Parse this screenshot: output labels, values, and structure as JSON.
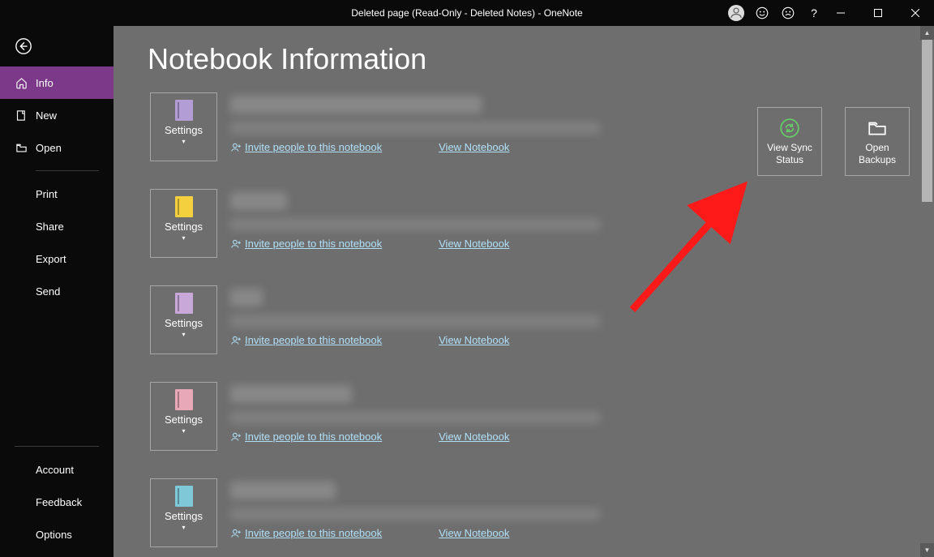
{
  "title": "Deleted page (Read-Only - Deleted Notes)  -  OneNote",
  "pageHeading": "Notebook Information",
  "sidebar": {
    "info": "Info",
    "new": "New",
    "open": "Open",
    "print": "Print",
    "share": "Share",
    "export": "Export",
    "send": "Send",
    "account": "Account",
    "feedback": "Feedback",
    "options": "Options"
  },
  "settingsLabel": "Settings",
  "viewSync": "View Sync Status",
  "openBackups": "Open Backups",
  "invite": "Invite people to this notebook",
  "viewNb": "View Notebook",
  "notebooks": [
    {
      "colorClass": "nb-c0",
      "nameW": 310
    },
    {
      "colorClass": "nb-c1",
      "nameW": 70
    },
    {
      "colorClass": "nb-c2",
      "nameW": 40
    },
    {
      "colorClass": "nb-c3",
      "nameW": 150
    },
    {
      "colorClass": "nb-c4",
      "nameW": 130
    }
  ]
}
